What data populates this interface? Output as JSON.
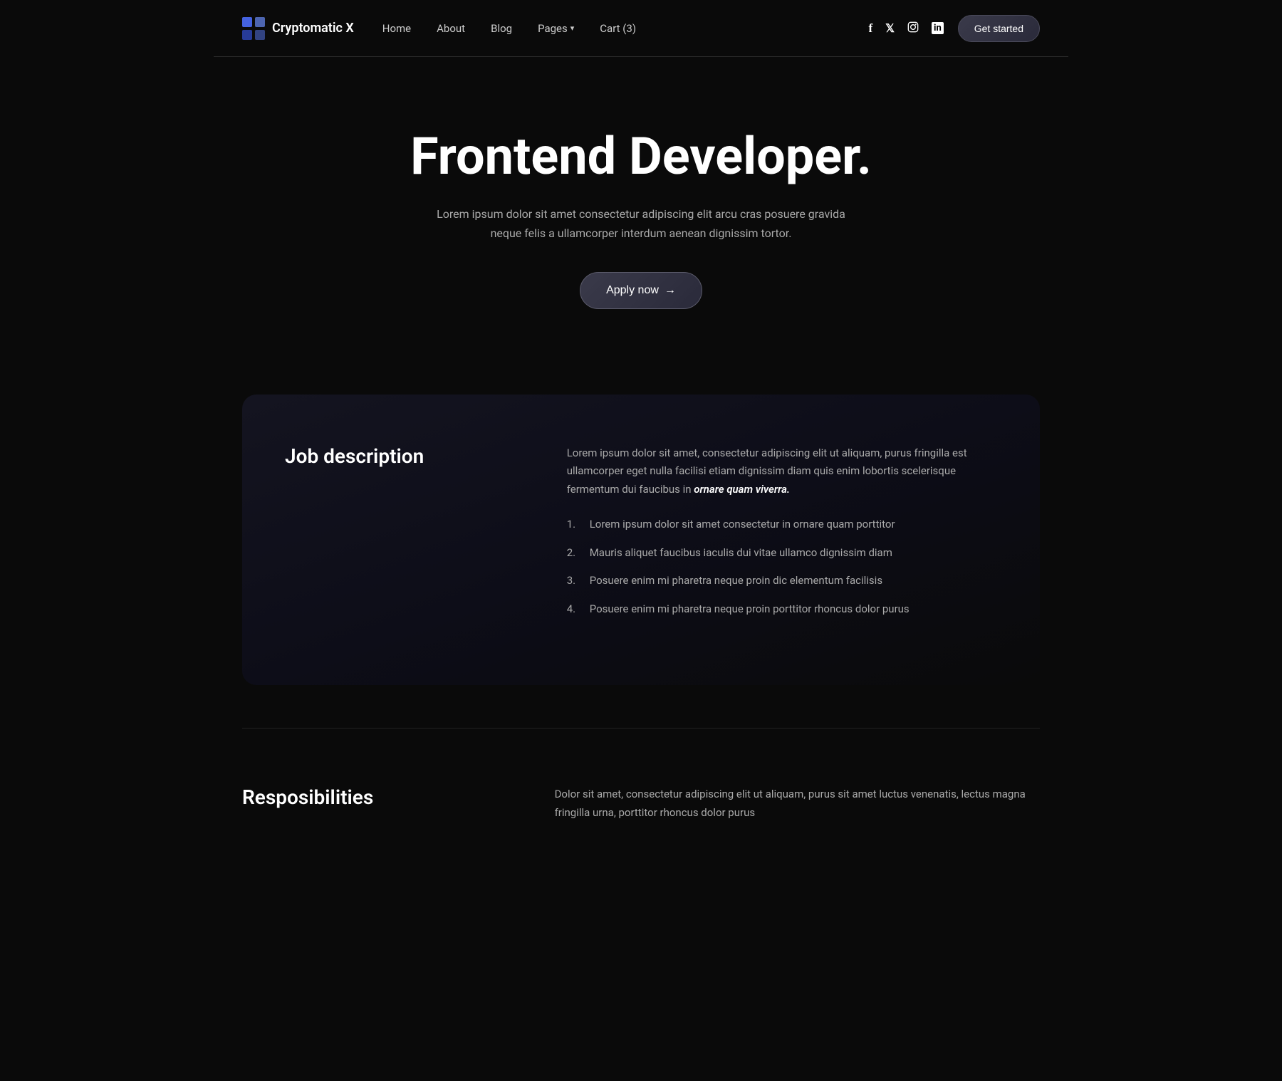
{
  "brand": {
    "name": "Cryptomatic X"
  },
  "nav": {
    "links": [
      {
        "label": "Home",
        "id": "home"
      },
      {
        "label": "About",
        "id": "about"
      },
      {
        "label": "Blog",
        "id": "blog"
      },
      {
        "label": "Pages",
        "id": "pages"
      },
      {
        "label": "Cart (3)",
        "id": "cart"
      }
    ],
    "pages_chevron": "▾",
    "get_started": "Get started"
  },
  "social": {
    "icons": [
      {
        "name": "facebook-icon",
        "symbol": "f"
      },
      {
        "name": "twitter-icon",
        "symbol": "𝕏"
      },
      {
        "name": "instagram-icon",
        "symbol": "◎"
      },
      {
        "name": "linkedin-icon",
        "symbol": "in"
      }
    ]
  },
  "hero": {
    "title": "Frontend Developer.",
    "subtitle": "Lorem ipsum dolor sit amet consectetur adipiscing elit arcu cras posuere gravida neque felis a ullamcorper interdum aenean dignissim tortor.",
    "apply_button": "Apply now",
    "apply_arrow": "→"
  },
  "job_description": {
    "heading": "Job description",
    "intro": "Lorem ipsum dolor sit amet, consectetur adipiscing elit ut aliquam, purus fringilla est ullamcorper eget nulla facilisi etiam dignissim diam quis enim lobortis scelerisque fermentum dui faucibus in ",
    "highlight": "ornare quam viverra.",
    "list": [
      "Lorem ipsum dolor sit amet consectetur in ornare quam porttitor",
      "Mauris aliquet faucibus iaculis dui vitae ullamco dignissim diam",
      "Posuere enim mi pharetra neque proin dic elementum facilisis",
      "Posuere enim mi pharetra neque proin porttitor rhoncus dolor purus"
    ]
  },
  "responsibilities": {
    "heading": "Resposibilities",
    "content": "Dolor sit amet, consectetur adipiscing elit ut aliquam, purus sit amet luctus venenatis, lectus magna fringilla urna, porttitor rhoncus dolor purus"
  }
}
